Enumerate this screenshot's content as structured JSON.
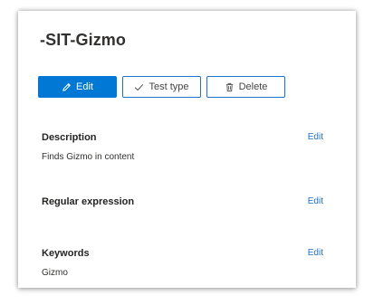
{
  "page": {
    "title": "-SIT-Gizmo"
  },
  "toolbar": {
    "edit_label": "Edit",
    "test_type_label": "Test type",
    "delete_label": "Delete"
  },
  "sections": {
    "description": {
      "title": "Description",
      "edit_label": "Edit",
      "value": "Finds Gizmo in content"
    },
    "regular_expression": {
      "title": "Regular expression",
      "edit_label": "Edit"
    },
    "keywords": {
      "title": "Keywords",
      "edit_label": "Edit",
      "value": "Gizmo"
    }
  },
  "icons": {
    "edit": "pencil-icon",
    "test_type": "checkmark-icon",
    "delete": "trash-icon"
  },
  "colors": {
    "accent": "#0078d4",
    "link": "#1f6fc0",
    "button_border": "#1a73c9"
  }
}
